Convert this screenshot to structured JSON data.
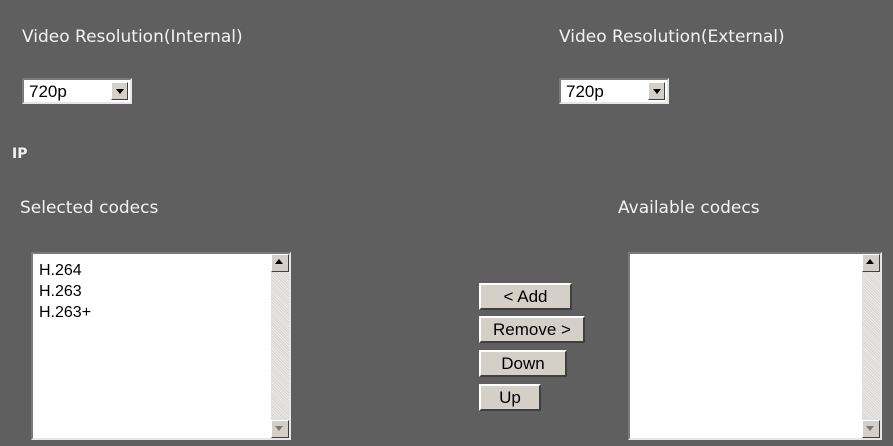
{
  "video": {
    "internal": {
      "label": "Video Resolution(Internal)",
      "selected": "720p"
    },
    "external": {
      "label": "Video Resolution(External)",
      "selected": "720p"
    }
  },
  "ip": {
    "section_label": "IP"
  },
  "codecs": {
    "selected_label": "Selected codecs",
    "available_label": "Available codecs",
    "selected_items": [
      "H.264",
      "H.263",
      "H.263+"
    ],
    "available_items": []
  },
  "buttons": {
    "add": "< Add",
    "remove": "Remove >",
    "down": "Down",
    "up": "Up"
  }
}
